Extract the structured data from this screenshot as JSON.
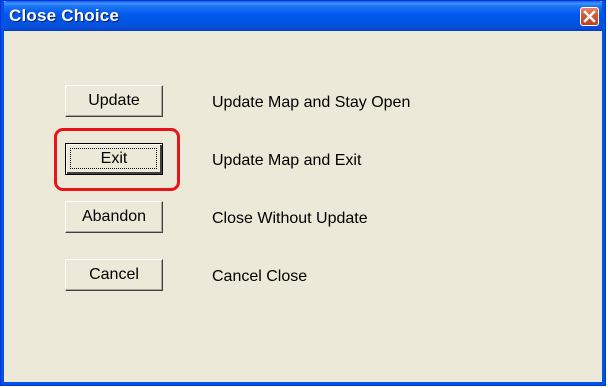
{
  "window": {
    "title": "Close Choice"
  },
  "options": [
    {
      "button": "Update",
      "description": "Update Map and Stay Open"
    },
    {
      "button": "Exit",
      "description": "Update Map and Exit"
    },
    {
      "button": "Abandon",
      "description": "Close Without Update"
    },
    {
      "button": "Cancel",
      "description": "Cancel Close"
    }
  ],
  "colors": {
    "titlebar": "#0054e3",
    "dialog_bg": "#ece9d8",
    "highlight": "#e8141a",
    "close_button": "#d95a3a"
  },
  "icons": {
    "close": "close-icon"
  }
}
